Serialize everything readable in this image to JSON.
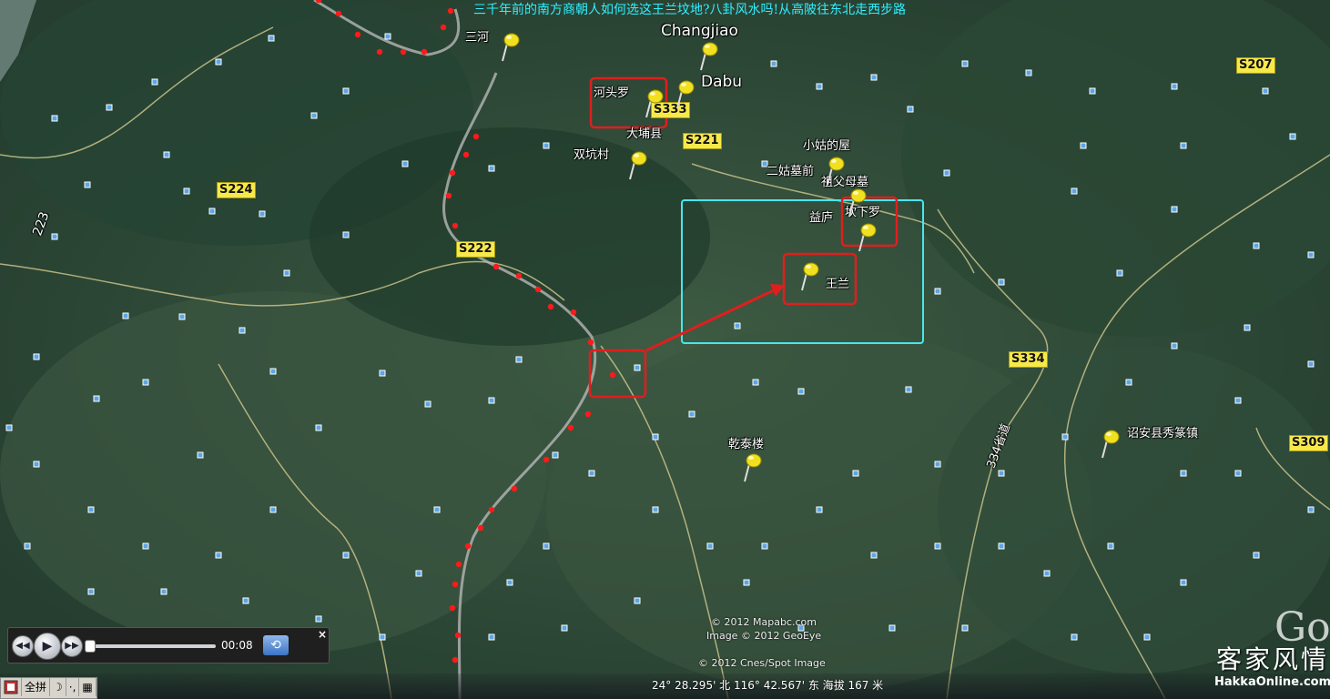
{
  "title": "三千年前的南方商朝人如何选这王兰坟地?八卦风水吗!从高陂往东北走西步路",
  "places": {
    "changjiao": "Changjiao",
    "dabu": "Dabu",
    "sanhe": "三河",
    "hetouluo": "河头罗",
    "dabuxian": "大埔县",
    "shuangkeng": "双坑村",
    "xiaogu": "小姑的屋",
    "ergu": "二姑墓前",
    "zufumu": "祖父母墓",
    "yilu": "益庐",
    "kanxialuo": "坎下罗",
    "wanglan": "王兰",
    "qiantai": "乾泰楼",
    "zhaoan": "诏安县秀篆镇"
  },
  "roads": {
    "s207": "S207",
    "s333": "S333",
    "s221": "S221",
    "s224": "S224",
    "s222": "S222",
    "s334": "S334",
    "s309": "S309",
    "r223": "223",
    "r334": "334省道"
  },
  "credits": {
    "mapabc": "© 2012 Mapabc.com",
    "geoeye": "Image © 2012 GeoEye",
    "cnes": "© 2012 Cnes/Spot Image"
  },
  "player": {
    "time": "00:08",
    "progress": 0.0,
    "close": "×"
  },
  "toolbar": {
    "fullscreen": "全拼",
    "moon": "☽",
    "dot": "·,",
    "kbd": "▦"
  },
  "status": {
    "coordinates": "24° 28.295' 北 116° 42.567' 东 海拔 167 米"
  },
  "branding": {
    "name": "客家风情",
    "site": "HakkaOnline.com",
    "google": "Go"
  },
  "colors": {
    "title": "#2ff0ff",
    "route_dots": "#ff1a1a",
    "highlight_box": "#e01e1e",
    "cyan_box": "#48e6ee",
    "road_label": "#f7e94a",
    "pin": "#f0e020"
  }
}
